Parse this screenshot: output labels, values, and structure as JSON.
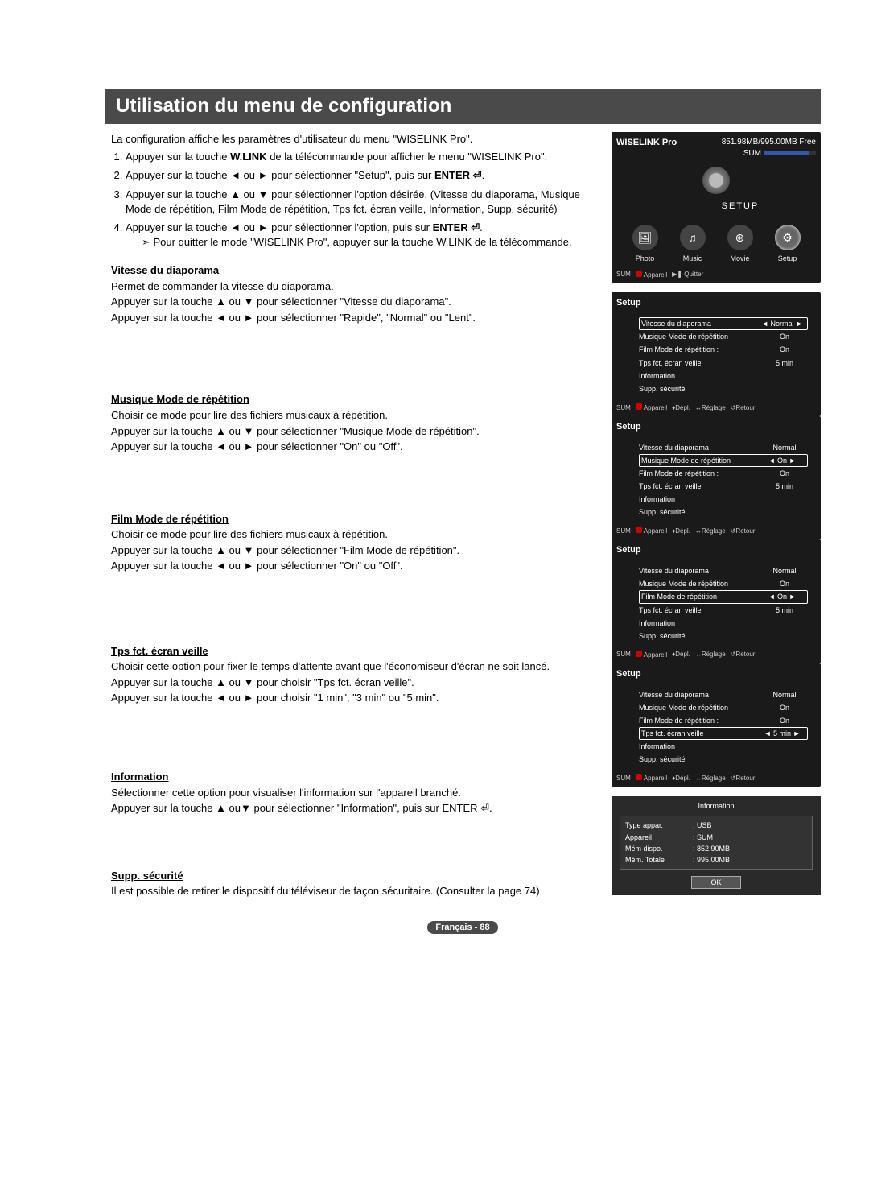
{
  "title": "Utilisation du menu de configuration",
  "intro": "La configuration affiche les paramètres d'utilisateur du menu \"WISELINK Pro\".",
  "steps": [
    {
      "pre": "Appuyer sur la touche ",
      "b": "W.LINK",
      "post": " de la télécommande pour afficher le menu \"WISELINK Pro\"."
    },
    {
      "pre": "Appuyer sur la touche ◄ ou ► pour sélectionner \"Setup\", puis sur ",
      "b": "ENTER ⏎",
      "post": "."
    },
    {
      "pre": "Appuyer sur la touche ▲ ou ▼ pour sélectionner l'option désirée. (Vitesse du diaporama, Musique Mode de répétition, Film Mode de répétition, Tps fct. écran veille, Information, Supp. sécurité)",
      "b": "",
      "post": ""
    },
    {
      "pre": "Appuyer sur la touche ◄ ou ► pour sélectionner l'option, puis sur ",
      "b": "ENTER ⏎",
      "post": "."
    }
  ],
  "step4_sub": "Pour quitter le mode \"WISELINK Pro\", appuyer sur la touche W.LINK de la télécommande.",
  "sections": {
    "vitesse": {
      "h": "Vitesse du diaporama",
      "p": [
        "Permet de commander la vitesse du diaporama.",
        "Appuyer sur la touche ▲ ou ▼ pour sélectionner \"Vitesse du diaporama\".",
        "Appuyer sur la touche ◄ ou ► pour sélectionner \"Rapide\", \"Normal\" ou \"Lent\"."
      ]
    },
    "musique": {
      "h": "Musique Mode de répétition",
      "p": [
        "Choisir ce mode pour lire des fichiers musicaux à répétition.",
        "Appuyer sur la touche ▲ ou ▼ pour sélectionner \"Musique Mode de répétition\".",
        "Appuyer sur la touche ◄ ou ► pour sélectionner \"On\" ou \"Off\"."
      ]
    },
    "film": {
      "h": "Film Mode de répétition",
      "p": [
        "Choisir ce mode pour lire des fichiers musicaux à répétition.",
        "Appuyer sur la touche ▲ ou ▼ pour sélectionner \"Film Mode de répétition\".",
        "Appuyer sur la touche ◄ ou ► pour sélectionner \"On\" ou \"Off\"."
      ]
    },
    "tps": {
      "h": "Tps fct. écran veille",
      "p": [
        "Choisir cette option pour fixer le temps d'attente avant que l'économiseur d'écran ne soit lancé.",
        "Appuyer sur la touche ▲ ou ▼ pour choisir \"Tps fct. écran veille\".",
        "Appuyer sur la touche ◄ ou ► pour choisir \"1 min\", \"3 min\" ou \"5 min\"."
      ]
    },
    "info": {
      "h": "Information",
      "p": [
        "Sélectionner cette option pour visualiser l'information sur l'appareil branché.",
        "Appuyer sur la touche ▲ ou▼ pour sélectionner \"Information\", puis sur ENTER ⏎."
      ]
    },
    "supp": {
      "h": "Supp. sécurité",
      "p": [
        "Il est possible de retirer le dispositif du téléviseur de façon sécuritaire. (Consulter la page 74)"
      ]
    }
  },
  "wiselink": {
    "brand": "WISELINK Pro",
    "free": "851.98MB/995.00MB Free",
    "sum": "SUM",
    "setup": "SETUP",
    "items": [
      {
        "icon": "🖼",
        "label": "Photo"
      },
      {
        "icon": "♫",
        "label": "Music"
      },
      {
        "icon": "⊛",
        "label": "Movie"
      },
      {
        "icon": "⚙",
        "label": "Setup"
      }
    ],
    "foot_sum": "SUM",
    "foot_app": "Appareil",
    "foot_quit": "Quitter"
  },
  "setup_panels": [
    {
      "sel": 0,
      "rows": [
        {
          "l": "Vitesse du diaporama",
          "v": "Normal"
        },
        {
          "l": "Musique Mode de répétition",
          "v": "On"
        },
        {
          "l": "Film Mode de répétition   :",
          "v": "On"
        },
        {
          "l": "Tps fct. écran veille",
          "v": "5 min"
        },
        {
          "l": "Information",
          "v": ""
        },
        {
          "l": "Supp. sécurité",
          "v": ""
        }
      ]
    },
    {
      "sel": 1,
      "rows": [
        {
          "l": "Vitesse du diaporama",
          "v": "Normal"
        },
        {
          "l": "Musique Mode de répétition",
          "v": "On"
        },
        {
          "l": "Film Mode de répétition   :",
          "v": "On"
        },
        {
          "l": "Tps fct. écran veille",
          "v": "5 min"
        },
        {
          "l": "Information",
          "v": ""
        },
        {
          "l": "Supp. sécurité",
          "v": ""
        }
      ]
    },
    {
      "sel": 2,
      "rows": [
        {
          "l": "Vitesse du diaporama",
          "v": "Normal"
        },
        {
          "l": "Musique Mode de répétition",
          "v": "On"
        },
        {
          "l": "Film Mode de répétition",
          "v": "On"
        },
        {
          "l": "Tps fct. écran veille",
          "v": "5 min"
        },
        {
          "l": "Information",
          "v": ""
        },
        {
          "l": "Supp. sécurité",
          "v": ""
        }
      ]
    },
    {
      "sel": 3,
      "rows": [
        {
          "l": "Vitesse du diaporama",
          "v": "Normal"
        },
        {
          "l": "Musique Mode de répétition",
          "v": "On"
        },
        {
          "l": "Film Mode de répétition   :",
          "v": "On"
        },
        {
          "l": "Tps fct. écran veille",
          "v": "5 min"
        },
        {
          "l": "Information",
          "v": ""
        },
        {
          "l": "Supp. sécurité",
          "v": ""
        }
      ]
    }
  ],
  "setup_title": "Setup",
  "setup_foot": {
    "sum": "SUM",
    "app": "Appareil",
    "depl": "Dépl.",
    "reg": "Réglage",
    "ret": "Retour"
  },
  "info_panel": {
    "title": "Information",
    "rows": [
      {
        "k": "Type appar.",
        "v": ": USB"
      },
      {
        "k": "Appareil",
        "v": ": SUM"
      },
      {
        "k": "Mém dispo.",
        "v": ": 852.90MB"
      },
      {
        "k": "Mém. Totale",
        "v": ": 995.00MB"
      }
    ],
    "ok": "OK"
  },
  "pagenum": "Français - 88"
}
